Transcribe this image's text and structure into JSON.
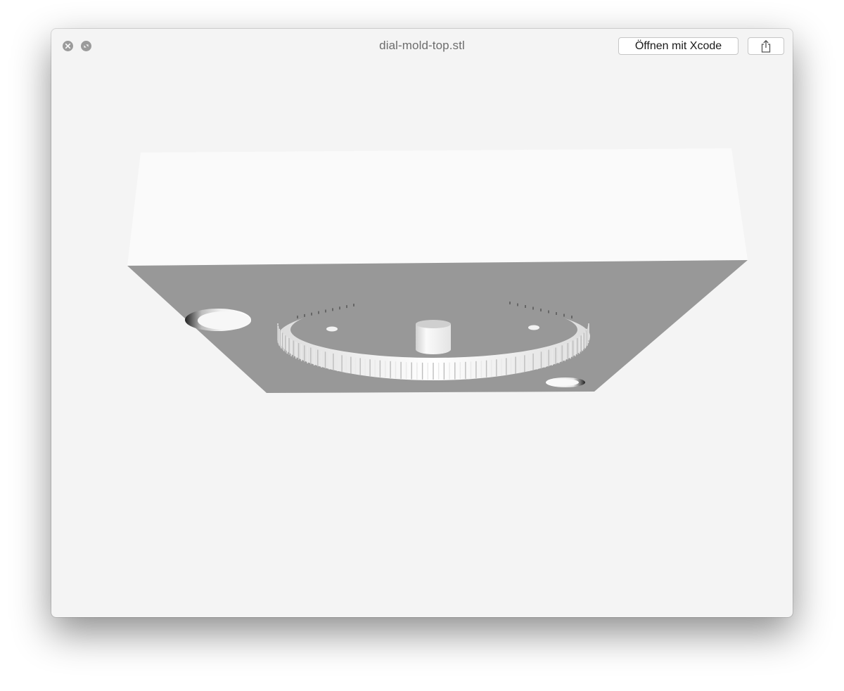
{
  "window": {
    "title": "dial-mold-top.stl"
  },
  "toolbar": {
    "open_with_label": "Öffnen mit Xcode",
    "share_icon": "share-icon",
    "close_icon": "close-icon",
    "fullscreen_icon": "fullscreen-icon"
  },
  "colors": {
    "window_background": "#f4f4f4",
    "model_top_face": "#fafafa",
    "model_front_face": "#989898",
    "traffic_light": "#9b9b9b"
  }
}
